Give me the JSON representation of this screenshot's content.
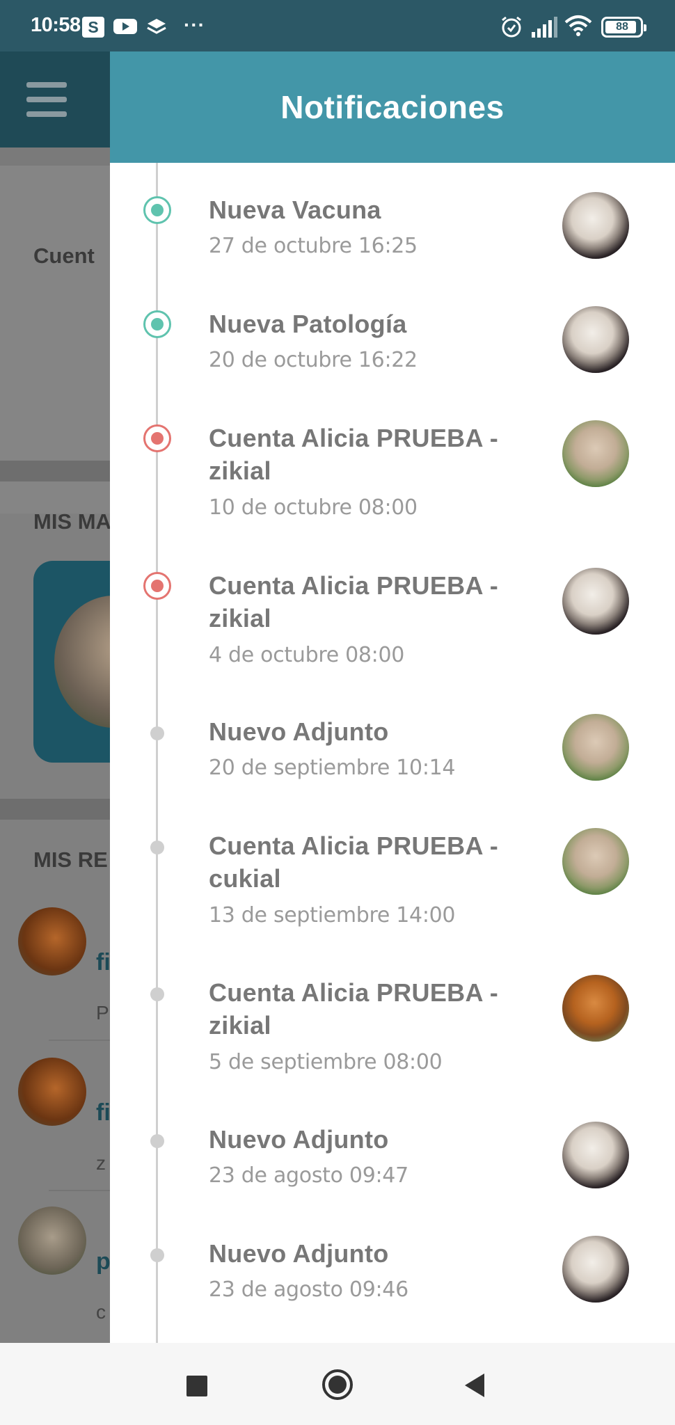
{
  "status_bar": {
    "time": "10:58",
    "s_badge": "S",
    "more": "···",
    "battery": "88",
    "icons": [
      "s-app-icon",
      "youtube-icon",
      "layers-icon",
      "more-icon",
      "alarm-icon",
      "signal-icon",
      "wifi-icon",
      "battery-icon"
    ]
  },
  "background": {
    "menu_icon": "hamburger-icon",
    "account_label": "Cuent",
    "pets_label": "MIS MA",
    "reminders_label": "MIS RE",
    "rows": [
      {
        "title": "fi",
        "sub": "P"
      },
      {
        "title": "fi",
        "sub": "z"
      },
      {
        "title": "p",
        "sub": "c"
      }
    ]
  },
  "drawer": {
    "title": "Notificaciones",
    "colors": {
      "header": "#4396a8",
      "green": "#5fc3ae",
      "red": "#e47470",
      "grey": "#cfcfcf"
    },
    "notifications": [
      {
        "title": "Nueva Vacuna",
        "date": "27 de octubre 16:25",
        "marker": "green",
        "avatar": "rabbit-dark"
      },
      {
        "title": "Nueva Patología",
        "date": "20 de octubre 16:22",
        "marker": "green",
        "avatar": "rabbit-dark"
      },
      {
        "title": "Cuenta Alicia PRUEBA - zikial",
        "date": "10 de octubre 08:00",
        "marker": "red",
        "avatar": "rabbit-green"
      },
      {
        "title": "Cuenta Alicia PRUEBA - zikial",
        "date": "4 de octubre 08:00",
        "marker": "red",
        "avatar": "rabbit-dark"
      },
      {
        "title": "Nuevo Adjunto",
        "date": "20 de septiembre 10:14",
        "marker": "grey",
        "avatar": "rabbit-green"
      },
      {
        "title": "Cuenta Alicia PRUEBA - cukial",
        "date": "13 de septiembre 14:00",
        "marker": "grey",
        "avatar": "rabbit-green"
      },
      {
        "title": "Cuenta Alicia PRUEBA - zikial",
        "date": "5 de septiembre 08:00",
        "marker": "grey",
        "avatar": "dog"
      },
      {
        "title": "Nuevo Adjunto",
        "date": "23 de agosto 09:47",
        "marker": "grey",
        "avatar": "rabbit-dark"
      },
      {
        "title": "Nuevo Adjunto",
        "date": "23 de agosto 09:46",
        "marker": "grey",
        "avatar": "rabbit-dark"
      }
    ]
  },
  "nav_bar": {
    "buttons": [
      "recents-square-icon",
      "home-circle-icon",
      "back-triangle-icon"
    ]
  }
}
